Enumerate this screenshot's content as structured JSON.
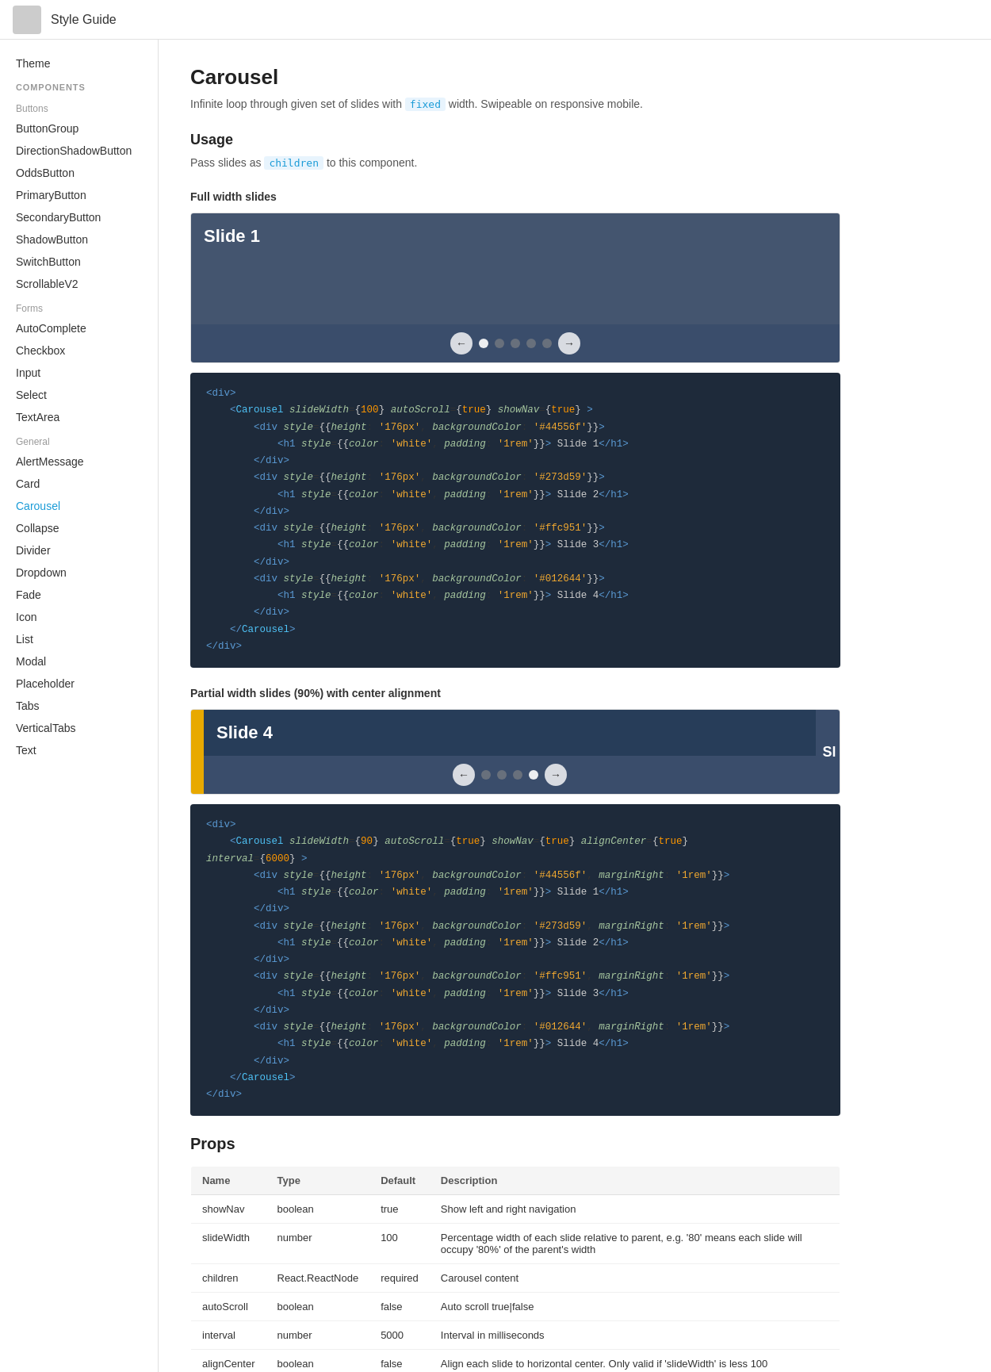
{
  "header": {
    "title": "Style Guide",
    "logo_alt": "logo"
  },
  "sidebar": {
    "theme_label": "Theme",
    "components_label": "COMPONENTS",
    "buttons_label": "Buttons",
    "buttons_items": [
      "ButtonGroup",
      "DirectionShadowButton",
      "OddsButton",
      "PrimaryButton",
      "SecondaryButton",
      "ShadowButton",
      "SwitchButton",
      "ScrollableV2"
    ],
    "forms_label": "Forms",
    "forms_items": [
      "AutoComplete",
      "Checkbox",
      "Input",
      "Select",
      "TextArea"
    ],
    "general_label": "General",
    "general_items": [
      "AlertMessage",
      "Card",
      "Carousel",
      "Collapse",
      "Divider",
      "Dropdown",
      "Fade",
      "Icon",
      "List",
      "Modal",
      "Placeholder",
      "Tabs",
      "VerticalTabs",
      "Text"
    ]
  },
  "main": {
    "page_title": "Carousel",
    "page_desc_prefix": "Infinite loop through given set of slides with ",
    "page_desc_tag": "fixed",
    "page_desc_suffix": " width. Swipeable on responsive mobile.",
    "usage_title": "Usage",
    "usage_desc_prefix": "Pass slides as ",
    "usage_tag": "children",
    "usage_desc_suffix": " to this component.",
    "full_width_title": "Full width slides",
    "slide1_label": "Slide 1",
    "partial_width_title": "Partial width slides (90%) with center alignment",
    "slide4_label": "Slide 4",
    "slide_partial_right": "Sl",
    "props_title": "Props",
    "table": {
      "headers": [
        "Name",
        "Type",
        "Default",
        "Description"
      ],
      "rows": [
        [
          "showNav",
          "boolean",
          "true",
          "Show left and right navigation"
        ],
        [
          "slideWidth",
          "number",
          "100",
          "Percentage width of each slide relative to parent, e.g. '80' means each slide will occupy '80%' of the parent's width"
        ],
        [
          "children",
          "React.ReactNode",
          "required",
          "Carousel content"
        ],
        [
          "autoScroll",
          "boolean",
          "false",
          "Auto scroll true|false"
        ],
        [
          "interval",
          "number",
          "5000",
          "Interval in milliseconds"
        ],
        [
          "alignCenter",
          "boolean",
          "false",
          "Align each slide to horizontal center. Only valid if 'slideWidth' is less 100"
        ]
      ]
    },
    "code1": "<div>\n    <Carousel slideWidth={100} autoScroll={true} showNav={true} >\n        <div style={{height: '176px', backgroundColor: '#44556f'}}>\n            <h1 style={{color: 'white', padding: '1rem'}}> Slide 1</h1>\n        </div>\n        <div style={{height: '176px', backgroundColor: '#273d59'}}>\n            <h1 style={{color: 'white', padding: '1rem'}}> Slide 2</h1>\n        </div>\n        <div style={{height: '176px', backgroundColor: '#ffc951'}}>\n            <h1 style={{color: 'white', padding: '1rem'}}> Slide 3</h1>\n        </div>\n        <div style={{height: '176px', backgroundColor: '#012644'}}>\n            <h1 style={{color: 'white', padding: '1rem'}}> Slide 4</h1>\n        </div>\n    </Carousel>\n</div>",
    "code2": "<div>\n    <Carousel slideWidth={90} autoScroll={true} showNav={true} alignCenter={true}\ninterval={6000} >\n        <div style={{height: '176px', backgroundColor: '#44556f', marginRight: '1rem'}}>\n            <h1 style={{color: 'white', padding: '1rem'}}> Slide 1</h1>\n        </div>\n        <div style={{height: '176px', backgroundColor: '#273d59', marginRight: '1rem'}}>\n            <h1 style={{color: 'white', padding: '1rem'}}> Slide 2</h1>\n        </div>\n        <div style={{height: '176px', backgroundColor: '#ffc951', marginRight: '1rem'}}>\n            <h1 style={{color: 'white', padding: '1rem'}}> Slide 3</h1>\n        </div>\n        <div style={{height: '176px', backgroundColor: '#012644', marginRight: '1rem'}}>\n            <h1 style={{color: 'white', padding: '1rem'}}> Slide 4</h1>\n        </div>\n    </Carousel>\n</div>"
  }
}
